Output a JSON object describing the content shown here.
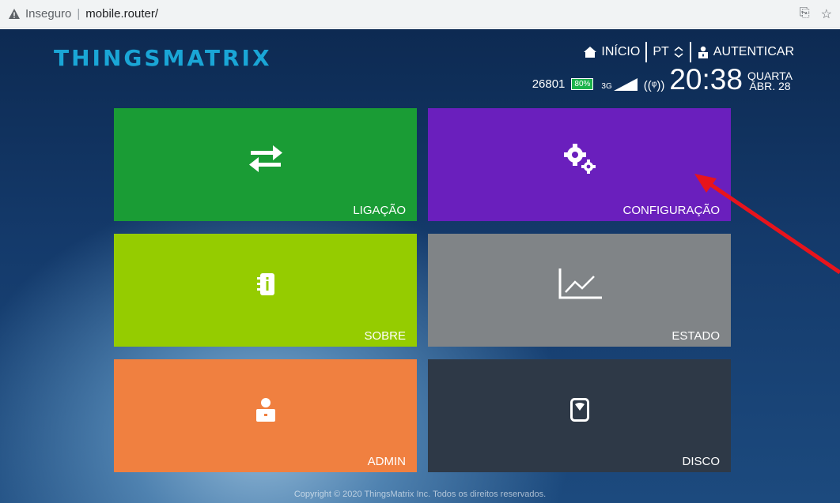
{
  "browser": {
    "security_label": "Inseguro",
    "separator": "|",
    "url": "mobile.router/",
    "translate_icon": "translate-icon",
    "star_icon": "star-icon"
  },
  "header": {
    "logo_text": "THINGSMATRIX",
    "nav": {
      "home_label": "INÍCIO",
      "lang_label": "PT",
      "login_label": "AUTENTICAR"
    },
    "status": {
      "id": "26801",
      "battery": "80%",
      "network": "3G",
      "time": "20:38",
      "weekday": "QUARTA",
      "date": "ABR. 28"
    }
  },
  "tiles": [
    {
      "label": "LIGAÇÃO",
      "icon": "exchange-icon",
      "color": "#1a9c35"
    },
    {
      "label": "CONFIGURAÇÃO",
      "icon": "gears-icon",
      "color": "#6a1fbd"
    },
    {
      "label": "SOBRE",
      "icon": "info-notebook-icon",
      "color": "#95cc00"
    },
    {
      "label": "ESTADO",
      "icon": "line-chart-icon",
      "color": "#808487"
    },
    {
      "label": "ADMIN",
      "icon": "user-admin-icon",
      "color": "#f08040"
    },
    {
      "label": "DISCO",
      "icon": "sd-card-icon",
      "color": "#2e3947"
    }
  ],
  "footer": {
    "copyright": "Copyright © 2020 ThingsMatrix Inc. Todos os direitos reservados."
  },
  "colors": {
    "accent_logo": "#1aa6d6",
    "annotation_arrow": "#e8141c"
  }
}
